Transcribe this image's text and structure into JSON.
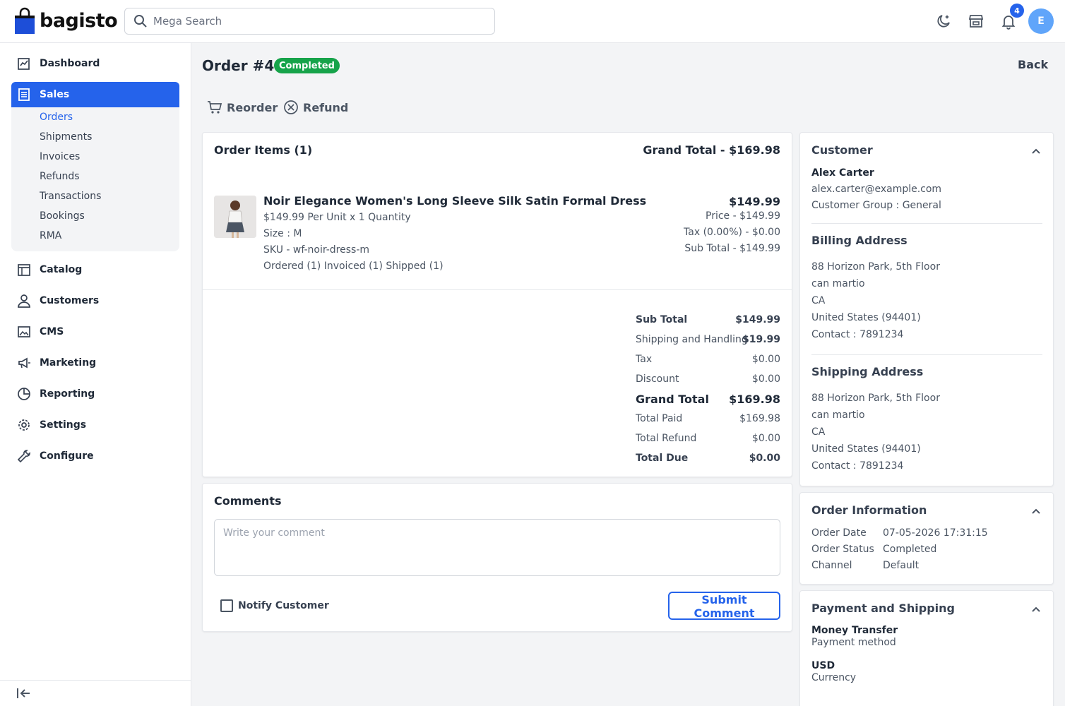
{
  "header": {
    "logo_text": "bagisto",
    "search_placeholder": "Mega Search",
    "notification_count": "4",
    "avatar_initial": "E"
  },
  "sidebar": {
    "items": [
      {
        "label": "Dashboard"
      },
      {
        "label": "Sales"
      },
      {
        "label": "Catalog"
      },
      {
        "label": "Customers"
      },
      {
        "label": "CMS"
      },
      {
        "label": "Marketing"
      },
      {
        "label": "Reporting"
      },
      {
        "label": "Settings"
      },
      {
        "label": "Configure"
      }
    ],
    "sales_submenu": [
      "Orders",
      "Shipments",
      "Invoices",
      "Refunds",
      "Transactions",
      "Bookings",
      "RMA"
    ]
  },
  "page": {
    "title": "Order #4",
    "status": "Completed",
    "back_label": "Back",
    "actions": {
      "reorder": "Reorder",
      "refund": "Refund"
    }
  },
  "order_items": {
    "title": "Order Items (1)",
    "grand_total_label": "Grand Total - $169.98",
    "item": {
      "name": "Noir Elegance Women's Long Sleeve Silk Satin Formal Dress",
      "unit_line": "$149.99 Per Unit x 1 Quantity",
      "size": "Size : M",
      "sku": "SKU - wf-noir-dress-m",
      "status_line": "Ordered (1) Invoiced (1) Shipped (1)",
      "total": "$149.99",
      "price": "Price - $149.99",
      "tax": "Tax (0.00%) - $0.00",
      "sub_total": "Sub Total - $149.99"
    }
  },
  "summary": {
    "rows": [
      {
        "label": "Sub Total",
        "value": "$149.99"
      },
      {
        "label": "Shipping and Handling",
        "value": "$19.99"
      },
      {
        "label": "Tax",
        "value": "$0.00"
      },
      {
        "label": "Discount",
        "value": "$0.00"
      },
      {
        "label": "Grand Total",
        "value": "$169.98"
      },
      {
        "label": "Total Paid",
        "value": "$169.98"
      },
      {
        "label": "Total Refund",
        "value": "$0.00"
      },
      {
        "label": "Total Due",
        "value": "$0.00"
      }
    ]
  },
  "comments": {
    "title": "Comments",
    "placeholder": "Write your comment",
    "notify_label": "Notify Customer",
    "submit_label": "Submit Comment"
  },
  "customer": {
    "title": "Customer",
    "name": "Alex Carter",
    "email": "alex.carter@example.com",
    "group": "Customer Group : General",
    "billing": {
      "title": "Billing Address",
      "lines": [
        "88 Horizon Park, 5th Floor",
        "can martio",
        "CA",
        "United States (94401)",
        "Contact : 7891234"
      ]
    },
    "shipping": {
      "title": "Shipping Address",
      "lines": [
        "88 Horizon Park, 5th Floor",
        "can martio",
        "CA",
        "United States (94401)",
        "Contact : 7891234"
      ]
    }
  },
  "order_info": {
    "title": "Order Information",
    "rows": [
      {
        "label": "Order Date",
        "value": "07-05-2026 17:31:15"
      },
      {
        "label": "Order Status",
        "value": "Completed"
      },
      {
        "label": "Channel",
        "value": "Default"
      }
    ]
  },
  "payment": {
    "title": "Payment and Shipping",
    "method": "Money Transfer",
    "method_caption": "Payment method",
    "currency": "USD",
    "currency_caption": "Currency"
  },
  "colors": {
    "accent": "#2563eb",
    "status_completed": "#16a34a"
  }
}
